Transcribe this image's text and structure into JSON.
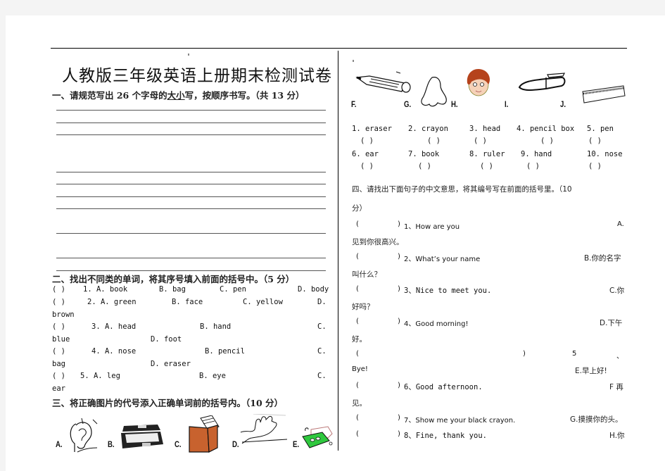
{
  "document": {
    "title": "人教版三年级英语上册期末检测试卷"
  },
  "section1": {
    "heading_pre": "一、请规范写出 26 个字母的",
    "heading_underlined": "大小",
    "heading_post": "写，按顺序书写。（共 13 分）"
  },
  "section2": {
    "heading": "二、找出不同类的单词，将其序号填入前面的括号中。（5 分）",
    "lines": [
      {
        "bracket": "(      )",
        "num": "1. A. book",
        "b": "B. bag",
        "c": "C. pen",
        "d": "D. body"
      },
      {
        "bracket": "(      )",
        "num": "2.  A.  green",
        "b": "B.  face",
        "c": "C.  yellow",
        "d": "D."
      },
      {
        "wrap": "brown"
      },
      {
        "bracket": "(      )",
        "num": "3.  A.  head",
        "b": "B.  hand",
        "c": "C."
      },
      {
        "wrap": "blue",
        "d": "D. foot"
      },
      {
        "bracket": "(      )",
        "num": "4.  A.  nose",
        "b": "B.  pencil",
        "c": "C."
      },
      {
        "wrap": "bag",
        "d": "D. eraser"
      },
      {
        "bracket": "(      )",
        "num": "5. A. leg",
        "b": "B. eye",
        "c": "C."
      },
      {
        "wrap": "ear"
      }
    ]
  },
  "section3": {
    "heading": "三、将正确图片的代号添入正确单词前的括号内。（10 分）",
    "pictures_row1": [
      {
        "label": "A.",
        "icon": "ear-icon"
      },
      {
        "label": "B.",
        "icon": "pencil-box-icon"
      },
      {
        "label": "C.",
        "icon": "book-icon"
      },
      {
        "label": "D.",
        "icon": "hand-icon"
      },
      {
        "label": "E.",
        "icon": "eraser-icon"
      }
    ],
    "pictures_row2": [
      {
        "label": "F.",
        "icon": "crayon-icon"
      },
      {
        "label": "G.",
        "icon": "nose-icon"
      },
      {
        "label": "H.",
        "icon": "head-icon"
      },
      {
        "label": "I.",
        "icon": "pen-icon"
      },
      {
        "label": "J.",
        "icon": "ruler-icon"
      }
    ],
    "words_row1": [
      "1. eraser",
      "2. crayon",
      "3. head",
      "4. pencil box",
      "5. pen"
    ],
    "words_row2": [
      "6. ear",
      "7. book",
      "8. ruler",
      "9. hand",
      "10. nose"
    ],
    "blank": "(   )"
  },
  "section4": {
    "heading_line1": "四、请找出下面句子的中文意思，将其编号写在前面的括号里。（10",
    "heading_line2": "分）",
    "items": [
      {
        "bracket": "(",
        "close": ")",
        "q": "1、How are you",
        "ans": "A.",
        "wrap": "见到你很高兴。"
      },
      {
        "bracket": "(",
        "close": ")",
        "q": "2、What’s your name",
        "ans": "B.你的名字",
        "wrap": "叫什么？"
      },
      {
        "bracket": "(",
        "close": ")",
        "q": "3、Nice to meet you.",
        "ans": "C.你",
        "wrap": "好吗？"
      },
      {
        "bracket": "(",
        "close": ")",
        "q": "4、Good morning!",
        "ans": "D.下午",
        "wrap": "好。"
      },
      {
        "bracket": "(",
        "close": ")",
        "q": "5",
        "ans": "、",
        "wrap": "Bye!",
        "wrap_ans": "E.早上好!"
      },
      {
        "bracket": "(",
        "close": ")",
        "q": "6、Good afternoon.",
        "ans": "F 再",
        "wrap": "见。"
      },
      {
        "bracket": "(",
        "close": ")",
        "q": "7、Show me your black crayon.",
        "ans": "G.摸摸你的头。"
      },
      {
        "bracket": "(",
        "close": ")",
        "q": "8、Fine, thank you.",
        "ans": "H.你"
      }
    ]
  }
}
